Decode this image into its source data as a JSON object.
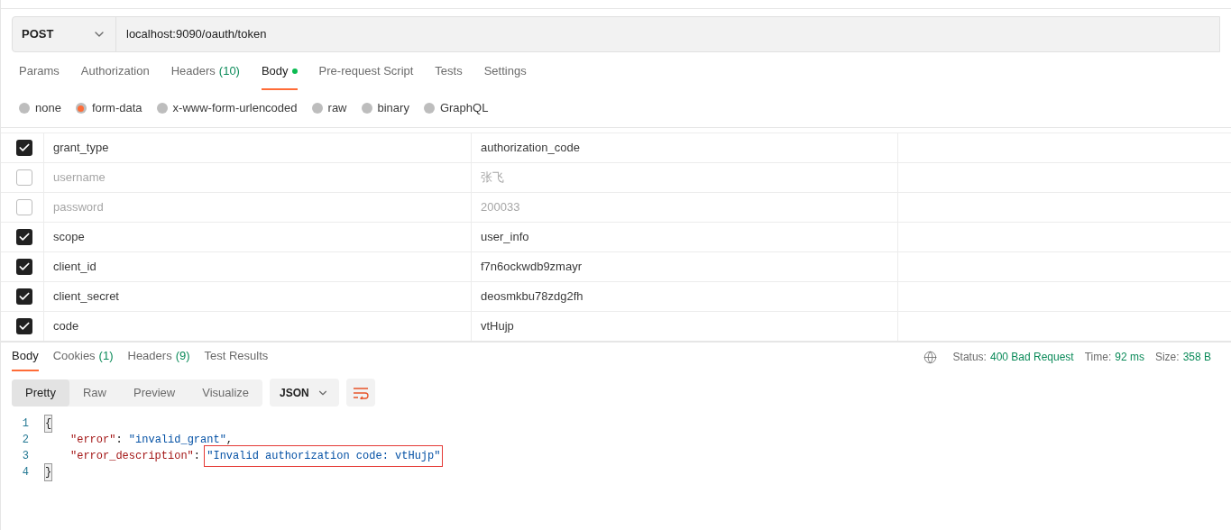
{
  "request": {
    "method": "POST",
    "url": "localhost:9090/oauth/token"
  },
  "tabs": [
    {
      "label": "Params",
      "selected": false
    },
    {
      "label": "Authorization",
      "selected": false
    },
    {
      "label": "Headers",
      "count": "(10)",
      "selected": false
    },
    {
      "label": "Body",
      "has_content": true,
      "selected": true
    },
    {
      "label": "Pre-request Script",
      "selected": false
    },
    {
      "label": "Tests",
      "selected": false
    },
    {
      "label": "Settings",
      "selected": false
    }
  ],
  "body_types": [
    {
      "label": "none",
      "selected": false
    },
    {
      "label": "form-data",
      "selected": true
    },
    {
      "label": "x-www-form-urlencoded",
      "selected": false
    },
    {
      "label": "raw",
      "selected": false
    },
    {
      "label": "binary",
      "selected": false
    },
    {
      "label": "GraphQL",
      "selected": false
    }
  ],
  "params": [
    {
      "key": "grant_type",
      "value": "authorization_code",
      "checked": true
    },
    {
      "key": "username",
      "value": "张飞",
      "checked": false
    },
    {
      "key": "password",
      "value": "200033",
      "checked": false
    },
    {
      "key": "scope",
      "value": "user_info",
      "checked": true
    },
    {
      "key": "client_id",
      "value": "f7n6ockwdb9zmayr",
      "checked": true
    },
    {
      "key": "client_secret",
      "value": "deosmkbu78zdg2fh",
      "checked": true
    },
    {
      "key": "code",
      "value": "vtHujp",
      "checked": true
    }
  ],
  "response": {
    "tabs": [
      {
        "label": "Body",
        "selected": true
      },
      {
        "label": "Cookies",
        "count": "(1)",
        "selected": false
      },
      {
        "label": "Headers",
        "count": "(9)",
        "selected": false
      },
      {
        "label": "Test Results",
        "selected": false
      }
    ],
    "status": [
      {
        "label": "Status:",
        "value": "400 Bad Request"
      },
      {
        "label": "Time:",
        "value": "92 ms"
      },
      {
        "label": "Size:",
        "value": "358 B"
      }
    ],
    "views": [
      {
        "label": "Pretty",
        "selected": true
      },
      {
        "label": "Raw",
        "selected": false
      },
      {
        "label": "Preview",
        "selected": false
      },
      {
        "label": "Visualize",
        "selected": false
      }
    ],
    "format": "JSON",
    "lines": [
      {
        "number": "1",
        "indented": false,
        "tokens": [
          {
            "kind": "bracket",
            "text": "{"
          }
        ]
      },
      {
        "number": "2",
        "indented": true,
        "tokens": [
          {
            "kind": "key",
            "text": "\"error\""
          },
          {
            "kind": "punct",
            "text": ": "
          },
          {
            "kind": "string",
            "text": "\"invalid_grant\""
          },
          {
            "kind": "punct",
            "text": ","
          }
        ]
      },
      {
        "number": "3",
        "indented": true,
        "tokens": [
          {
            "kind": "key",
            "text": "\"error_description\""
          },
          {
            "kind": "punct",
            "text": ": "
          },
          {
            "kind": "string",
            "text": "\"Invalid authorization code: vtHujp\"",
            "highlighted": true
          }
        ]
      },
      {
        "number": "4",
        "indented": false,
        "tokens": [
          {
            "kind": "bracket",
            "text": "}"
          }
        ]
      }
    ]
  }
}
